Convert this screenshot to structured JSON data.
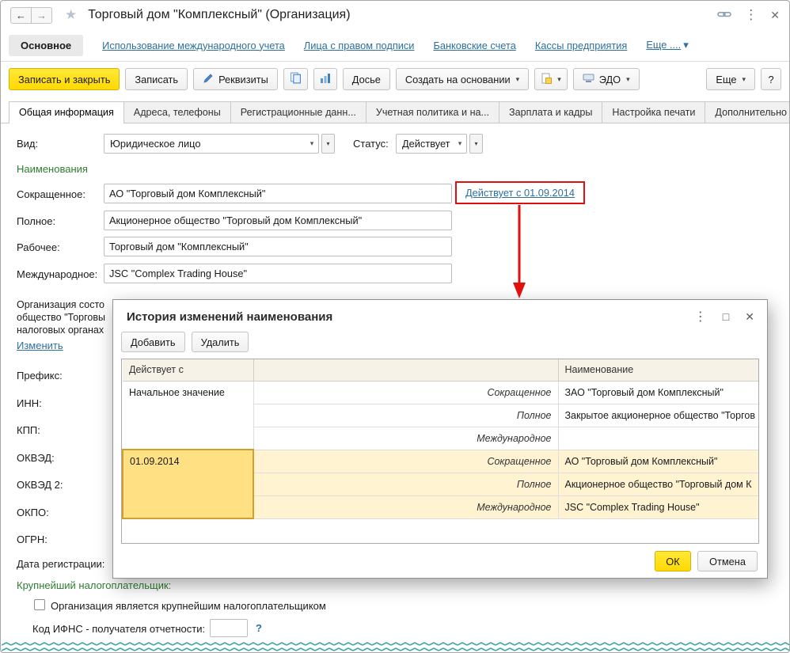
{
  "titlebar": {
    "back": "←",
    "forward": "→",
    "title": "Торговый дом \"Комплексный\" (Организация)"
  },
  "nav": {
    "main": "Основное",
    "links": [
      "Использование международного учета",
      "Лица с правом подписи",
      "Банковские счета",
      "Кассы предприятия"
    ],
    "more": "Еще ...."
  },
  "toolbar": {
    "save_close": "Записать и закрыть",
    "save": "Записать",
    "requisites": "Реквизиты",
    "dossier": "Досье",
    "create_from": "Создать на основании",
    "edo": "ЭДО",
    "more": "Еще",
    "help": "?"
  },
  "tabs": [
    "Общая информация",
    "Адреса, телефоны",
    "Регистрационные данн...",
    "Учетная политика и на...",
    "Зарплата и кадры",
    "Настройка печати",
    "Дополнительно"
  ],
  "form": {
    "vid_label": "Вид:",
    "vid_value": "Юридическое лицо",
    "status_label": "Статус:",
    "status_value": "Действует",
    "section_title": "Наименования",
    "short_label": "Сокращенное:",
    "short_value": "АО \"Торговый дом Комплексный\"",
    "history_link": "Действует с 01.09.2014",
    "full_label": "Полное:",
    "full_value": "Акционерное общество \"Торговый дом Комплексный\"",
    "working_label": "Рабочее:",
    "working_value": "Торговый дом \"Комплексный\"",
    "intl_label": "Международное:",
    "intl_value": "JSC \"Complex Trading House\"",
    "org_line1": "Организация состо",
    "org_line2": "общество \"Торговы",
    "org_line3": "налоговых органах",
    "change_link": "Изменить",
    "prefix_label": "Префикс:",
    "inn_label": "ИНН:",
    "kpp_label": "КПП:",
    "okved_label": "ОКВЭД:",
    "okved2_label": "ОКВЭД 2:",
    "okpo_label": "ОКПО:",
    "ogrn_label": "ОГРН:",
    "regdate_label": "Дата регистрации:",
    "taxpayer_section": "Крупнейший налогоплательщик:",
    "taxpayer_checkbox": "Организация является крупнейшим налогоплательщиком",
    "ifns_label": "Код ИФНС - получателя отчетности:",
    "ifns_help": "?"
  },
  "dialog": {
    "title": "История изменений наименования",
    "add_button": "Добавить",
    "delete_button": "Удалить",
    "col_date": "Действует с",
    "col_name": "Наименование",
    "rows": [
      {
        "date": "Начальное значение",
        "type": "Сокращенное",
        "value": "ЗАО \"Торговый дом Комплексный\""
      },
      {
        "type": "Полное",
        "value": "Закрытое акционерное общество \"Торгов"
      },
      {
        "type": "Международное",
        "value": ""
      },
      {
        "date": "01.09.2014",
        "type": "Сокращенное",
        "value": "АО \"Торговый дом Комплексный\""
      },
      {
        "type": "Полное",
        "value": "Акционерное общество \"Торговый дом К"
      },
      {
        "type": "Международное",
        "value": "JSC \"Complex Trading House\""
      }
    ],
    "ok_button": "ОК",
    "cancel_button": "Отмена"
  },
  "colors": {
    "accent_yellow": "#ffd900",
    "link_blue": "#2d6f9e",
    "section_green": "#2e7d32",
    "highlight_row": "#fff3d2",
    "highlight_cell": "#ffe083",
    "alert_red": "#e01010",
    "zigzag_teal": "#3aa6a0"
  }
}
